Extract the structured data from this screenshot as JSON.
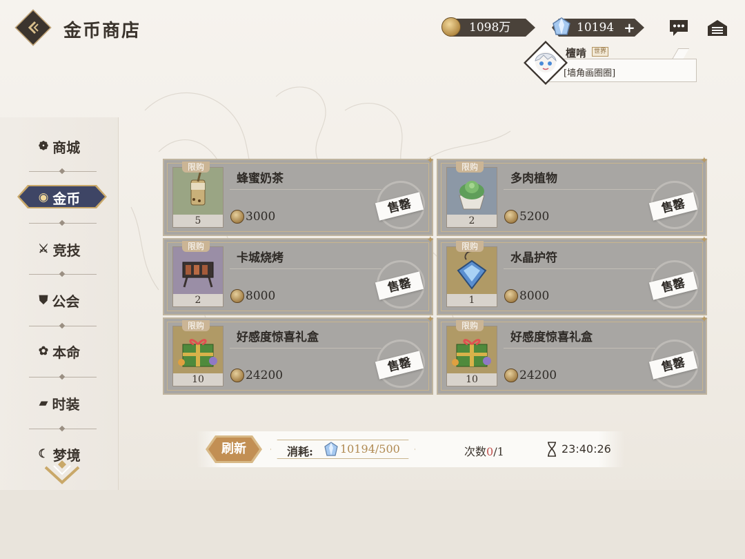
{
  "header": {
    "title": "金币商店",
    "gold_amount": "1098万",
    "gem_amount": "10194",
    "plus_symbol": "+"
  },
  "chat": {
    "user_name": "檀啃",
    "channel": "世界",
    "message": "[墙角画圈圈]"
  },
  "sidebar": {
    "items": [
      {
        "label": "商城",
        "icon": "shop-icon"
      },
      {
        "label": "金币",
        "icon": "coin-icon",
        "active": true
      },
      {
        "label": "竞技",
        "icon": "swords-icon"
      },
      {
        "label": "公会",
        "icon": "shield-icon"
      },
      {
        "label": "本命",
        "icon": "flower-icon"
      },
      {
        "label": "时装",
        "icon": "hat-icon"
      },
      {
        "label": "梦境",
        "icon": "moon-icon"
      }
    ]
  },
  "items": [
    {
      "name": "蜂蜜奶茶",
      "qty": "5",
      "price": "3000",
      "badge": "限购",
      "status": "售罄"
    },
    {
      "name": "多肉植物",
      "qty": "2",
      "price": "5200",
      "badge": "限购",
      "status": "售罄"
    },
    {
      "name": "卡城烧烤",
      "qty": "2",
      "price": "8000",
      "badge": "限购",
      "status": "售罄"
    },
    {
      "name": "水晶护符",
      "qty": "1",
      "price": "8000",
      "badge": "限购",
      "status": "售罄"
    },
    {
      "name": "好感度惊喜礼盒",
      "qty": "10",
      "price": "24200",
      "badge": "限购",
      "status": "售罄"
    },
    {
      "name": "好感度惊喜礼盒",
      "qty": "10",
      "price": "24200",
      "badge": "限购",
      "status": "售罄"
    }
  ],
  "bottom": {
    "refresh_label": "刷新",
    "cost_label": "消耗:",
    "cost_value": "10194/500",
    "count_label": "次数",
    "count_used": "0",
    "count_total": "/1",
    "timer": "23:40:26"
  },
  "colors": {
    "accent_gold": "#c28f54",
    "nav_active": "#3e4565",
    "card_bg": "#a8a6a3"
  }
}
